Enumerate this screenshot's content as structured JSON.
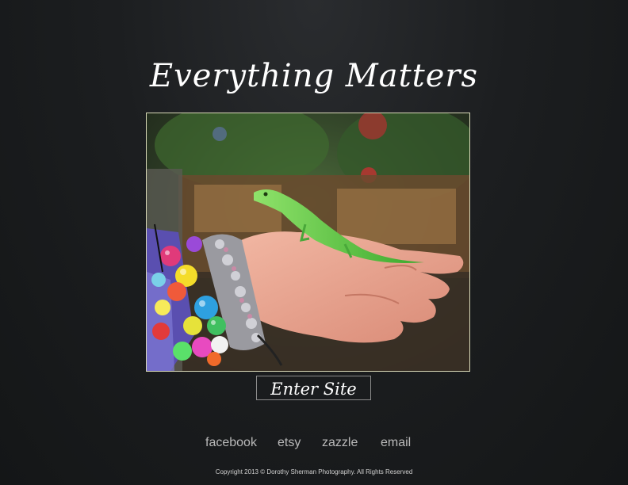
{
  "header": {
    "title": "Everything Matters"
  },
  "hero": {
    "enter_label": "Enter Site"
  },
  "social": {
    "facebook": "facebook",
    "etsy": "etsy",
    "zazzle": "zazzle",
    "email": "email"
  },
  "footer": {
    "copyright": "Copyright 2013 © Dorothy Sherman Photography. All Rights Reserved"
  },
  "colors": {
    "background": "#1c1e20",
    "frame_border": "#d9d9b8",
    "link": "#b9b9b9"
  }
}
